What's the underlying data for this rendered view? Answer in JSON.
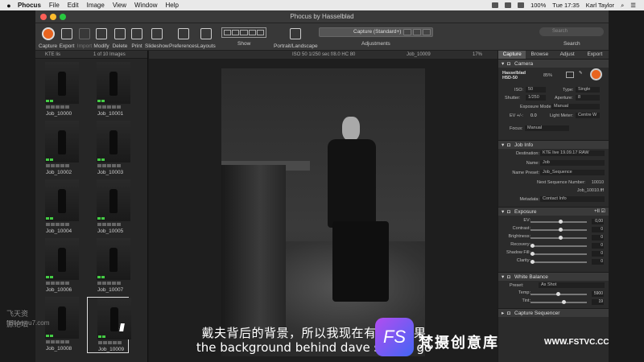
{
  "menubar": {
    "app": "Phocus",
    "items": [
      "File",
      "Edit",
      "Image",
      "View",
      "Window",
      "Help"
    ],
    "time": "Tue 17:35",
    "user": "Karl Taylor",
    "battery": "100%"
  },
  "window": {
    "title": "Phocus by Hasselblad"
  },
  "toolbar": {
    "buttons": [
      {
        "label": "Capture",
        "icon": "capture-icon"
      },
      {
        "label": "Export",
        "icon": "export-icon"
      },
      {
        "label": "Import",
        "icon": "import-icon"
      },
      {
        "label": "Modify",
        "icon": "modify-icon"
      },
      {
        "label": "Delete",
        "icon": "delete-icon"
      },
      {
        "label": "Print",
        "icon": "print-icon"
      },
      {
        "label": "Slideshow",
        "icon": "slideshow-icon"
      },
      {
        "label": "Preferences",
        "icon": "preferences-icon"
      },
      {
        "label": "Layouts",
        "icon": "layouts-icon"
      }
    ],
    "show_label": "Show",
    "portrait_label": "Portrait/Landscape",
    "adjustments_value": "Capture (Standard+)",
    "adjustments_label": "Adjustments",
    "search_placeholder": "Search",
    "search_label": "Search"
  },
  "browser": {
    "folder": "KTE lis",
    "count": "1 of 10 Images",
    "thumbs": [
      "Job_10000",
      "Job_10001",
      "Job_10002",
      "Job_10003",
      "Job_10004",
      "Job_10005",
      "Job_10006",
      "Job_10007",
      "Job_10008",
      "Job_10009"
    ]
  },
  "viewer": {
    "info": "ISO 50  1/250 sec  f/8.0  HC 80",
    "filename": "Job_10009",
    "zoom": "17%"
  },
  "panel": {
    "tabs": [
      "Capture",
      "Browse",
      "Adjust",
      "Export"
    ],
    "camera": {
      "title": "Camera",
      "model": "Hasselblad H5D-50",
      "battery": "85%",
      "iso_label": "ISO:",
      "iso": "50",
      "type_label": "Type:",
      "type": "Single",
      "shutter_label": "Shutter:",
      "shutter": "1/250",
      "aperture_label": "Aperture:",
      "aperture": "8",
      "expmode_label": "Exposure Mode:",
      "expmode": "Manual",
      "ev_label": "EV +/-:",
      "ev": "0.0",
      "lightmeter_label": "Light Meter:",
      "lightmeter": "Centre W",
      "focus_label": "Focus:",
      "focus": "Manual"
    },
    "jobinfo": {
      "title": "Job Info",
      "dest_label": "Destination:",
      "dest": "KTE live 19.09.17 RAW",
      "name_label": "Name:",
      "name": "Job",
      "preset_label": "Name Preset:",
      "preset": "Job_Sequence",
      "nextseq_label": "Next Sequence Number:",
      "nextseq": "10010",
      "nextname": "Job_10010.fff",
      "meta_label": "Metadata:",
      "meta": "Contact Info"
    },
    "exposure": {
      "title": "Exposure",
      "rows": [
        {
          "label": "EV:",
          "value": "0,00",
          "pos": 0.5
        },
        {
          "label": "Contrast:",
          "value": "0",
          "pos": 0.5
        },
        {
          "label": "Brightness:",
          "value": "0",
          "pos": 0.5
        },
        {
          "label": "Recovery:",
          "value": "0",
          "pos": 0
        },
        {
          "label": "Shadow Fill:",
          "value": "0",
          "pos": 0
        },
        {
          "label": "Clarity:",
          "value": "0",
          "pos": 0
        }
      ]
    },
    "whitebalance": {
      "title": "White Balance",
      "preset_label": "Preset:",
      "preset": "As Shot",
      "rows": [
        {
          "label": "Temp:",
          "value": "5900",
          "pos": 0.45
        },
        {
          "label": "Tint:",
          "value": "19",
          "pos": 0.55
        }
      ]
    },
    "sequencer": {
      "title": "Capture Sequencer"
    }
  },
  "overlay": {
    "subtitle_cn": "戴夫背后的背景，所以我现在有了，如果",
    "subtitle_en": "the background behind dave so i've go",
    "logo": "FS",
    "brand_cn": "梵摄创意库",
    "brand_url": "WWW.FSTVC.CC",
    "watermark_cn": "飞天资源论坛",
    "watermark_url": "feitianwu7.com"
  }
}
